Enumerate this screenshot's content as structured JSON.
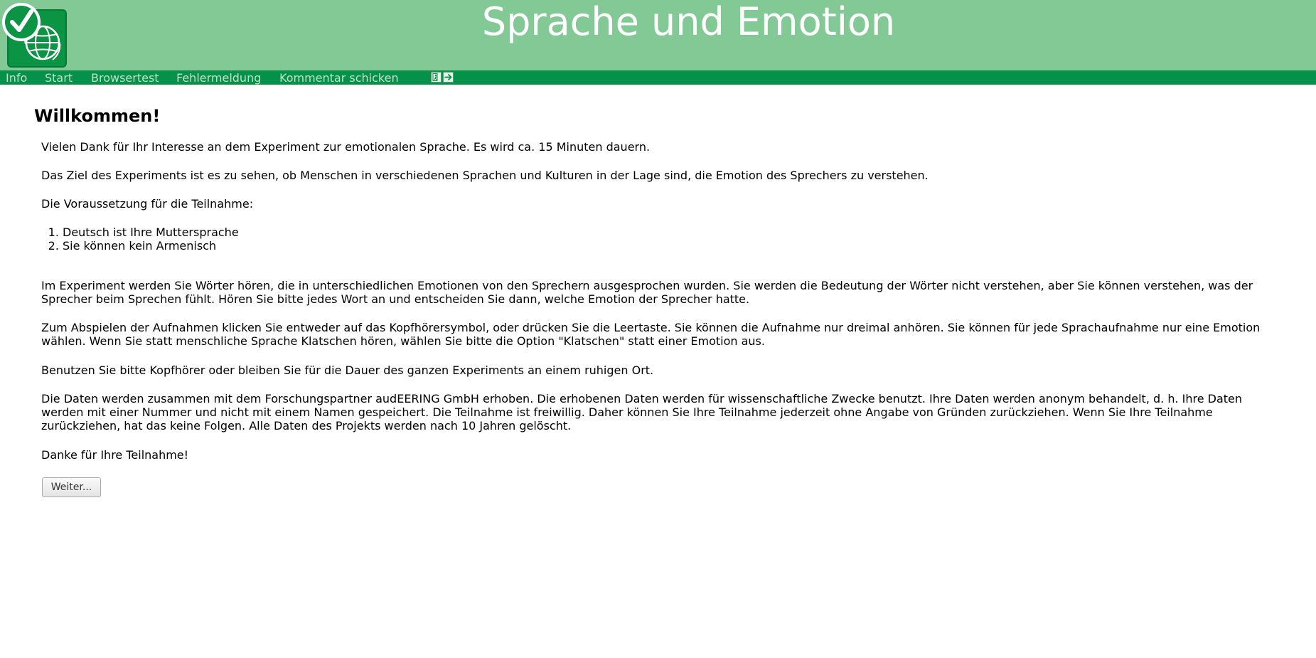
{
  "header": {
    "title": "Sprache und Emotion",
    "logo_icon": "checkmark-globe-logo"
  },
  "nav": {
    "items": [
      {
        "label": "Info"
      },
      {
        "label": "Start"
      },
      {
        "label": "Browsertest"
      },
      {
        "label": "Fehlermeldung"
      },
      {
        "label": "Kommentar schicken"
      }
    ],
    "icons": [
      "exit-person-icon",
      "arrow-right-icon"
    ]
  },
  "main": {
    "heading": "Willkommen!",
    "p1": "Vielen Dank für Ihr Interesse an dem Experiment zur emotionalen Sprache. Es wird ca. 15 Minuten dauern.",
    "p2": "Das Ziel des Experiments ist es zu sehen, ob Menschen in verschiedenen Sprachen und Kulturen in der Lage sind, die Emotion des Sprechers zu verstehen.",
    "p3": "Die Voraussetzung für die Teilnahme:",
    "requirements": [
      "Deutsch ist Ihre Muttersprache",
      "Sie können kein Armenisch"
    ],
    "p4": "Im Experiment werden Sie Wörter hören, die in unterschiedlichen Emotionen von den Sprechern ausgesprochen wurden. Sie werden die Bedeutung der Wörter nicht verstehen, aber Sie können verstehen, was der Sprecher beim Sprechen fühlt. Hören Sie bitte jedes Wort an und entscheiden Sie dann, welche Emotion der Sprecher hatte.",
    "p5": "Zum Abspielen der Aufnahmen klicken Sie entweder auf das Kopfhörersymbol, oder drücken Sie die Leertaste. Sie können die Aufnahme nur dreimal anhören. Sie können für jede Sprachaufnahme nur eine Emotion wählen. Wenn Sie statt menschliche Sprache Klatschen hören, wählen Sie bitte die Option \"Klatschen\" statt einer Emotion aus.",
    "p6": "Benutzen Sie bitte Kopfhörer oder bleiben Sie für die Dauer des ganzen Experiments an einem ruhigen Ort.",
    "p7": "Die Daten werden zusammen mit dem Forschungspartner audEERING GmbH erhoben. Die erhobenen Daten werden für wissenschaftliche Zwecke benutzt. Ihre Daten werden anonym behandelt, d. h. Ihre Daten werden mit einer Nummer und nicht mit einem Namen gespeichert. Die Teilnahme ist freiwillig. Daher können Sie Ihre Teilnahme jederzeit ohne Angabe von Gründen zurückziehen. Wenn Sie Ihre Teilnahme zurückziehen, hat das keine Folgen. Alle Daten des Projekts werden nach 10 Jahren gelöscht.",
    "p8": "Danke für Ihre Teilnahme!",
    "next_label": "Weiter..."
  },
  "colors": {
    "header_bg": "#82c996",
    "nav_bg": "#06914a",
    "nav_text": "#bfe0c9"
  }
}
